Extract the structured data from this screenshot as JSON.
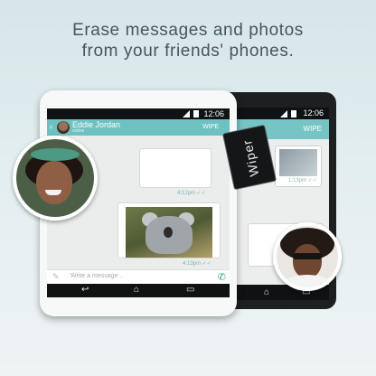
{
  "headline": {
    "line1": "Erase messages and photos",
    "line2": "from your friends' phones."
  },
  "front_phone": {
    "status_time": "12:06",
    "contact_name": "Eddie Jordan",
    "contact_sub": "online",
    "wipe_label": "WIPE",
    "text_bubble_meta": "4:12pm ✓✓",
    "photo_bubble_meta": "4:13pm ✓✓",
    "composer_placeholder": "Write a message...",
    "nav": {
      "back": "↩",
      "home": "⌂",
      "recent": "▭"
    }
  },
  "back_phone": {
    "status_time": "12:06",
    "wipe_label": "WIPE",
    "photo_meta": "1:13pm ✓✓",
    "nav": {
      "back": "↩",
      "home": "⌂",
      "recent": "▭"
    }
  },
  "wiper_tag": {
    "label": "Wiper"
  },
  "icons": {
    "back_arrow": "‹",
    "attach": "✎",
    "call": "✆"
  },
  "colors": {
    "accent": "#6fc1c1",
    "call_green": "#2c9f7f",
    "meta_teal": "#7fb2b2"
  }
}
